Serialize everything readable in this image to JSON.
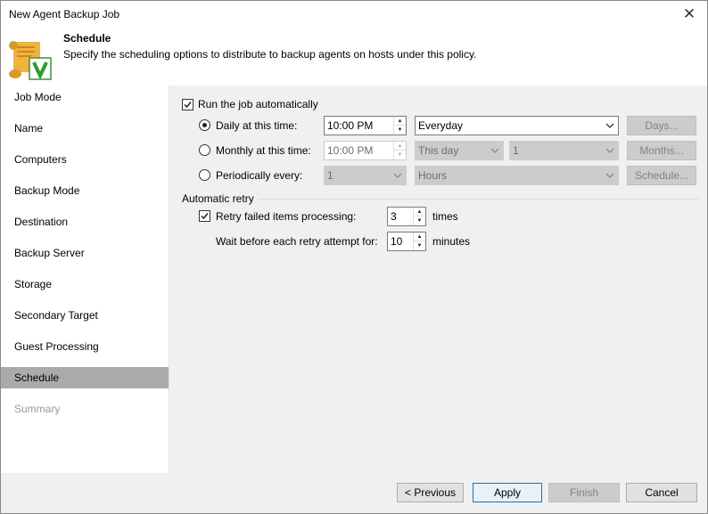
{
  "window": {
    "title": "New Agent Backup Job"
  },
  "header": {
    "title": "Schedule",
    "description": "Specify the scheduling options to distribute to backup agents on hosts under this policy."
  },
  "nav": {
    "items": [
      {
        "label": "Job Mode"
      },
      {
        "label": "Name"
      },
      {
        "label": "Computers"
      },
      {
        "label": "Backup Mode"
      },
      {
        "label": "Destination"
      },
      {
        "label": "Backup Server"
      },
      {
        "label": "Storage"
      },
      {
        "label": "Secondary Target"
      },
      {
        "label": "Guest Processing"
      },
      {
        "label": "Schedule"
      },
      {
        "label": "Summary"
      }
    ],
    "active_index": 9
  },
  "schedule": {
    "run_automatically": {
      "label": "Run the job automatically",
      "checked": true
    },
    "daily": {
      "label": "Daily at this time:",
      "selected": true,
      "time": "10:00 PM",
      "days_option": "Everyday",
      "button": "Days..."
    },
    "monthly": {
      "label": "Monthly at this time:",
      "selected": false,
      "time": "10:00 PM",
      "week_option": "This day",
      "day_option": "1",
      "button": "Months..."
    },
    "periodically": {
      "label": "Periodically every:",
      "selected": false,
      "interval": "1",
      "unit": "Hours",
      "button": "Schedule..."
    }
  },
  "retry": {
    "group_label": "Automatic retry",
    "retry_failed": {
      "label": "Retry failed items processing:",
      "checked": true,
      "value": "3",
      "unit": "times"
    },
    "wait": {
      "label": "Wait before each retry attempt for:",
      "value": "10",
      "unit": "minutes"
    }
  },
  "footer": {
    "previous": "< Previous",
    "apply": "Apply",
    "finish": "Finish",
    "cancel": "Cancel"
  }
}
